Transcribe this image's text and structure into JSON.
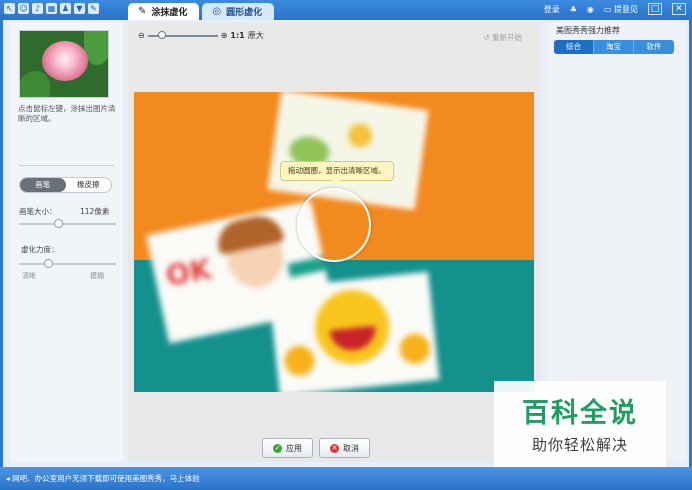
{
  "title_bar": {
    "tabs": [
      {
        "label": "涂抹虚化",
        "active": true
      },
      {
        "label": "圆形虚化",
        "active": false
      }
    ],
    "login": "登录",
    "feedback": "提意见",
    "window_buttons": [
      "□",
      "✕"
    ]
  },
  "left_panel": {
    "hint": "点击鼠标左键，涂抹出图片清晰的区域。",
    "tools": {
      "brush": "画笔",
      "eraser": "橡皮擦",
      "selected": "brush"
    },
    "brush_size": {
      "label": "画笔大小：",
      "value": "112像素",
      "level": 0.4
    },
    "blur_strength": {
      "label": "虚化力度：",
      "min_label": "清晰",
      "max_label": "模糊",
      "level": 0.3
    }
  },
  "canvas": {
    "zoom_label": "1:1",
    "original_label": "原大",
    "reset": "重新开始",
    "tooltip": "拖动圆圈，显示出清晰区域。",
    "image_text": "OK"
  },
  "actions": {
    "apply": "应用",
    "cancel": "取消"
  },
  "right_panel": {
    "title": "美图秀秀强力推荐",
    "tabs": [
      {
        "label": "综合",
        "active": true
      },
      {
        "label": "淘宝",
        "active": false
      },
      {
        "label": "软件",
        "active": false
      }
    ]
  },
  "status_bar": {
    "text": "网吧、办公室用户无须下载即可使用美图秀秀，马上体验"
  },
  "watermark": {
    "title": "百科全说",
    "subtitle": "助你轻松解决"
  },
  "colors": {
    "accent": "#2a73c9",
    "canvas_orange": "#f38a1f",
    "canvas_teal": "#15918d",
    "watermark_green": "#1e9e62"
  }
}
